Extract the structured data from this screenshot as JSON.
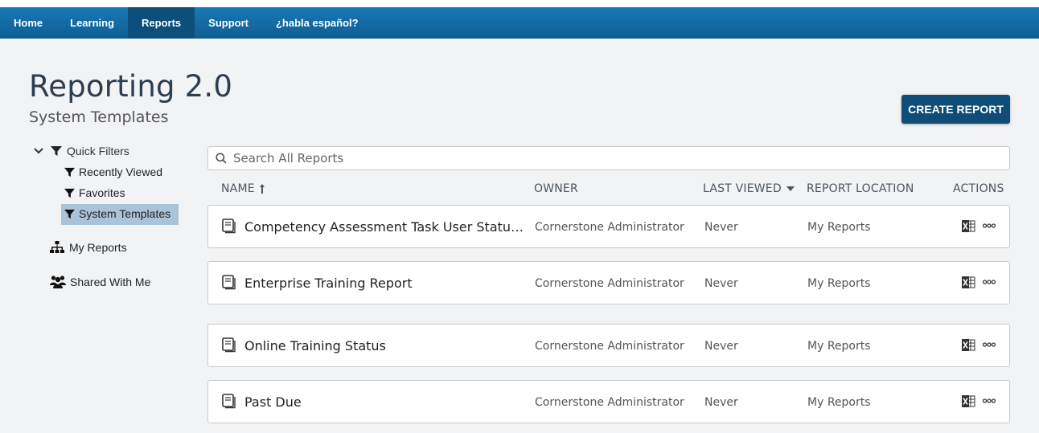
{
  "nav": {
    "items": [
      {
        "label": "Home"
      },
      {
        "label": "Learning"
      },
      {
        "label": "Reports"
      },
      {
        "label": "Support"
      },
      {
        "label": "¿habla español?"
      }
    ],
    "active": "Reports"
  },
  "page": {
    "title": "Reporting 2.0",
    "subtitle": "System Templates",
    "create_button": "CREATE REPORT"
  },
  "sidebar": {
    "quick_filters_label": "Quick Filters",
    "filters": [
      {
        "label": "Recently Viewed"
      },
      {
        "label": "Favorites"
      },
      {
        "label": "System Templates"
      }
    ],
    "selected": "System Templates",
    "my_reports": "My Reports",
    "shared_with_me": "Shared With Me"
  },
  "search": {
    "placeholder": "Search All Reports"
  },
  "table": {
    "headers": {
      "name": "NAME",
      "owner": "OWNER",
      "last_viewed": "LAST VIEWED",
      "location": "REPORT LOCATION",
      "actions": "ACTIONS"
    },
    "rows": [
      {
        "name": "Competency Assessment Task User Status Tem...",
        "owner": "Cornerstone Administrator",
        "last_viewed": "Never",
        "location": "My Reports"
      },
      {
        "name": "Enterprise Training Report",
        "owner": "Cornerstone Administrator",
        "last_viewed": "Never",
        "location": "My Reports"
      },
      {
        "name": "Online Training Status",
        "owner": "Cornerstone Administrator",
        "last_viewed": "Never",
        "location": "My Reports"
      },
      {
        "name": "Past Due",
        "owner": "Cornerstone Administrator",
        "last_viewed": "Never",
        "location": "My Reports"
      }
    ]
  },
  "colors": {
    "nav_bar": "#1a78b5",
    "nav_active": "#0d4f7c",
    "create_button": "#0f4d78",
    "sidebar_selected": "#a9c4d8"
  }
}
